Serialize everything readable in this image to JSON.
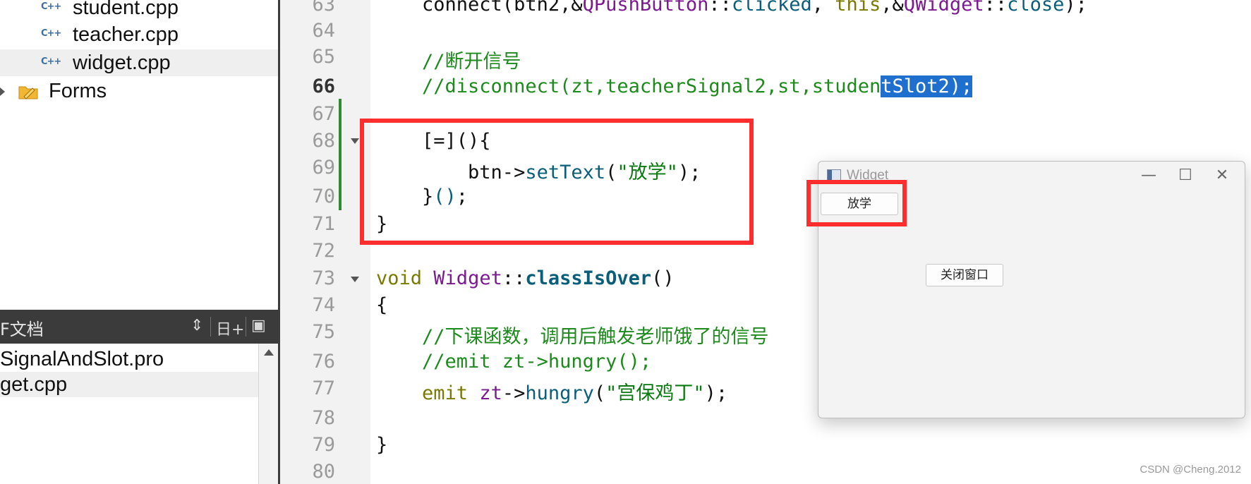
{
  "project_tree": {
    "files": [
      "student.cpp",
      "teacher.cpp",
      "widget.cpp"
    ],
    "cpp_icon_text": "C++",
    "forms_label": "Forms"
  },
  "open_documents": {
    "title": "打开文档",
    "visible_title": "F文档",
    "controls": [
      "⇕",
      "日+",
      "▣"
    ],
    "items": [
      "SignalAndSlot.pro",
      "get.cpp"
    ]
  },
  "editor": {
    "current_line": 66,
    "line_numbers": [
      "63",
      "64",
      "65",
      "66",
      "67",
      "68",
      "69",
      "70",
      "71",
      "72",
      "73",
      "74",
      "75",
      "76",
      "77",
      "78",
      "79",
      "80"
    ],
    "lines": {
      "l63": [
        "    connect(btn2,&",
        "QPushButton",
        "::",
        "clicked",
        ", ",
        "this",
        ",&",
        "QWidget",
        "::",
        "close",
        ");"
      ],
      "l65": "    //断开信号",
      "l66_plain": "    //disconnect(zt,teacherSignal2,st,studen",
      "l66_selected": "tSlot2);",
      "l68": "    [=](){",
      "l69": [
        "        btn->",
        "setText",
        "(",
        "\"放学\"",
        ");"
      ],
      "l70": [
        "    }",
        "()",
        ";"
      ],
      "l71": "}",
      "l73": [
        "void",
        " ",
        "Widget",
        "::",
        "classIsOver",
        "()"
      ],
      "l74": "{",
      "l75": "    //下课函数，调用后触发老师饿了的信号",
      "l76": "    //emit zt->hungry();",
      "l77": [
        "    emit ",
        "zt",
        "->",
        "hungry",
        "(",
        "\"宫保鸡丁\"",
        ");"
      ],
      "l79": "}"
    }
  },
  "widget_window": {
    "title": "Widget",
    "minimize": "—",
    "maximize": "☐",
    "close": "✕",
    "button_fangxue": "放学",
    "button_close_window": "关闭窗口"
  },
  "watermark": "CSDN @Cheng.2012",
  "colors": {
    "highlight_box": "#ff2d2d",
    "selection": "#1f6fcf",
    "comment": "#1e8a1e",
    "change_bar": "#2e8b2e"
  }
}
